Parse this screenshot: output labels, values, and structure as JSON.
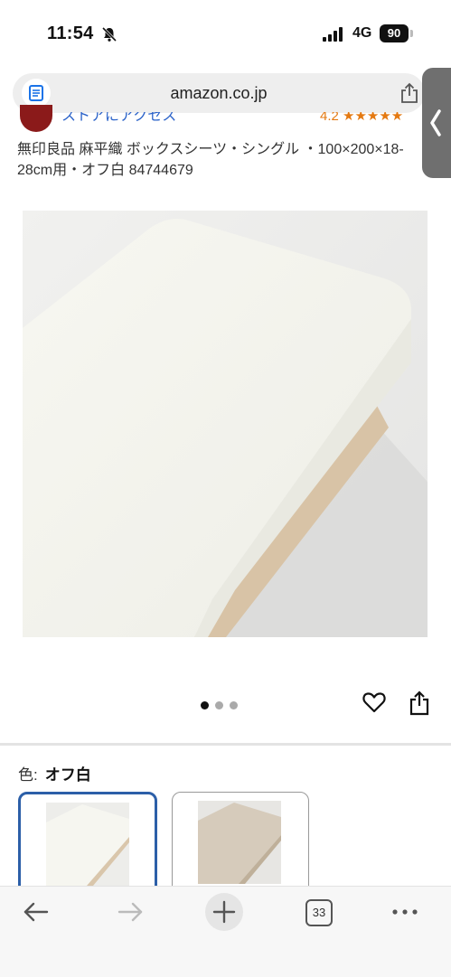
{
  "status": {
    "time": "11:54",
    "network": "4G",
    "battery": "90"
  },
  "browser": {
    "url": "amazon.co.jp",
    "tab_count": "33"
  },
  "seller": {
    "name_partial": "ストアにアクセス",
    "rating_partial": "4.2 ★★★★★"
  },
  "product": {
    "title": "無印良品 麻平織 ボックスシーツ・シングル ・100×200×18-28cm用・オフ白 84744679",
    "image_count": 3,
    "active_image": 1
  },
  "variation": {
    "label": "色:",
    "selected": "オフ白"
  }
}
